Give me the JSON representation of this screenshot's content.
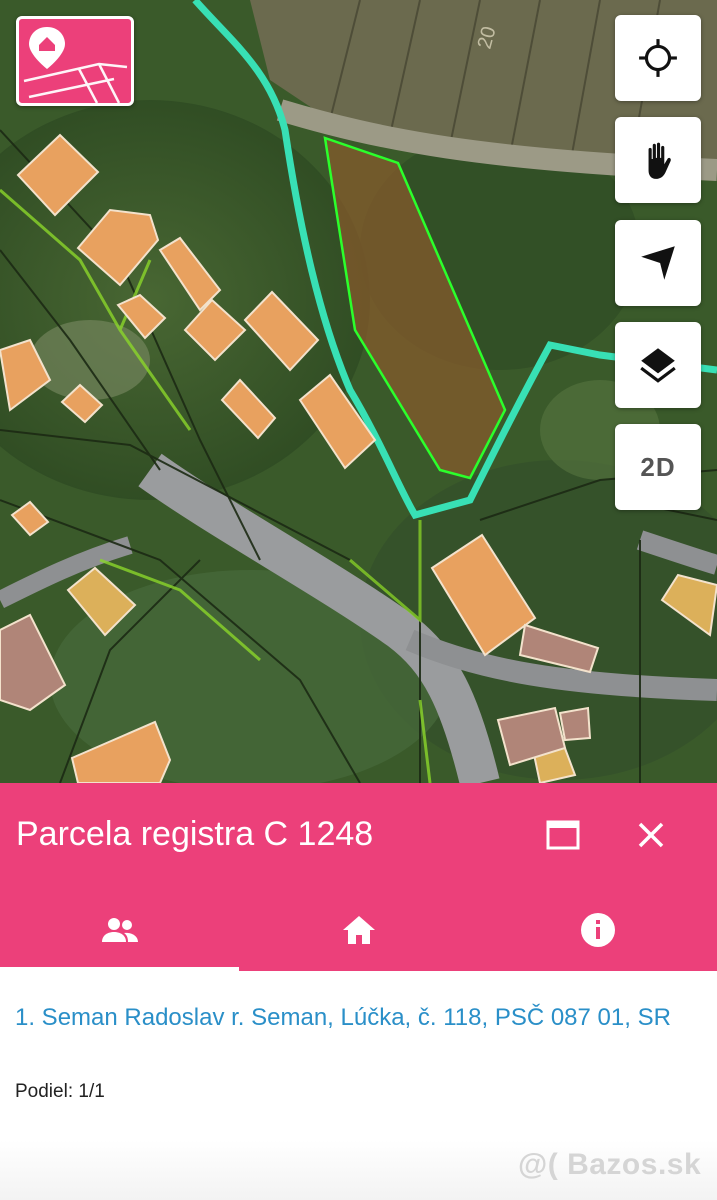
{
  "map": {
    "controls": [
      {
        "name": "locate-button",
        "icon": "crosshair-icon"
      },
      {
        "name": "pan-button",
        "icon": "hand-icon"
      },
      {
        "name": "navigate-button",
        "icon": "navigation-arrow-icon"
      },
      {
        "name": "layers-button",
        "icon": "layers-icon"
      }
    ],
    "view_mode_label": "2D",
    "colors": {
      "parcel_outline": "#2bff2b",
      "cadastral_boundary": "#38e0b5",
      "building": "#e8a15f"
    }
  },
  "panel": {
    "title": "Parcela registra C 1248",
    "accent": "#ec407a",
    "tabs": [
      {
        "name": "owners",
        "icon": "people-icon",
        "active": true
      },
      {
        "name": "property",
        "icon": "home-icon",
        "active": false
      },
      {
        "name": "info",
        "icon": "info-icon",
        "active": false
      }
    ],
    "owners": [
      {
        "text": "1. Seman Radoslav r. Seman, Lúčka, č. 118, PSČ 087 01, SR",
        "share_label": "Podiel:",
        "share_value": "1/1"
      }
    ]
  },
  "watermark": "@( Bazos.sk"
}
